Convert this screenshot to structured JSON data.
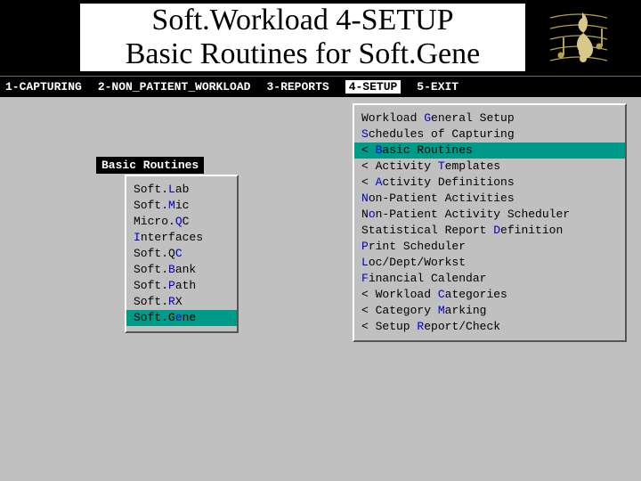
{
  "title": {
    "line1": "Soft.Workload 4-SETUP",
    "line2": "Basic Routines for Soft.Gene"
  },
  "menubar": [
    {
      "label": "1-CAPTURING",
      "active": false
    },
    {
      "label": "2-NON_PATIENT_WORKLOAD",
      "active": false
    },
    {
      "label": "3-REPORTS",
      "active": false
    },
    {
      "label": "4-SETUP",
      "active": true
    },
    {
      "label": "5-EXIT",
      "active": false
    }
  ],
  "setup_menu": [
    {
      "pre": "Workload ",
      "hot": "G",
      "post": "eneral Setup",
      "selected": false
    },
    {
      "pre": "",
      "hot": "S",
      "post": "chedules of Capturing",
      "selected": false
    },
    {
      "pre": "< ",
      "hot": "B",
      "post": "asic Routines",
      "selected": true
    },
    {
      "pre": "< Activity ",
      "hot": "T",
      "post": "emplates",
      "selected": false
    },
    {
      "pre": "< ",
      "hot": "A",
      "post": "ctivity Definitions",
      "selected": false
    },
    {
      "pre": "",
      "hot": "N",
      "post": "on-Patient Activities",
      "selected": false
    },
    {
      "pre": "N",
      "hot": "o",
      "post": "n-Patient Activity Scheduler",
      "selected": false
    },
    {
      "pre": "Statistical Report ",
      "hot": "D",
      "post": "efinition",
      "selected": false
    },
    {
      "pre": "",
      "hot": "P",
      "post": "rint Scheduler",
      "selected": false
    },
    {
      "pre": "",
      "hot": "L",
      "post": "oc/Dept/Workst",
      "selected": false
    },
    {
      "pre": "",
      "hot": "F",
      "post": "inancial Calendar",
      "selected": false
    },
    {
      "pre": "< Workload ",
      "hot": "C",
      "post": "ategories",
      "selected": false
    },
    {
      "pre": "< Category ",
      "hot": "M",
      "post": "arking",
      "selected": false
    },
    {
      "pre": "< Setup ",
      "hot": "R",
      "post": "eport/Check",
      "selected": false
    }
  ],
  "sub_title": "Basic Routines",
  "sub_menu": [
    {
      "pre": "Soft.",
      "hot": "L",
      "post": "ab",
      "selected": false
    },
    {
      "pre": "Soft.",
      "hot": "M",
      "post": "ic",
      "selected": false
    },
    {
      "pre": "Micro.",
      "hot": "Q",
      "post": "C",
      "selected": false
    },
    {
      "pre": "",
      "hot": "I",
      "post": "nterfaces",
      "selected": false
    },
    {
      "pre": "Soft.Q",
      "hot": "C",
      "post": "",
      "selected": false
    },
    {
      "pre": "Soft.",
      "hot": "B",
      "post": "ank",
      "selected": false
    },
    {
      "pre": "Soft.",
      "hot": "P",
      "post": "ath",
      "selected": false
    },
    {
      "pre": "Soft.",
      "hot": "R",
      "post": "X",
      "selected": false
    },
    {
      "pre": "Soft.G",
      "hot": "e",
      "post": "ne",
      "selected": true
    }
  ]
}
